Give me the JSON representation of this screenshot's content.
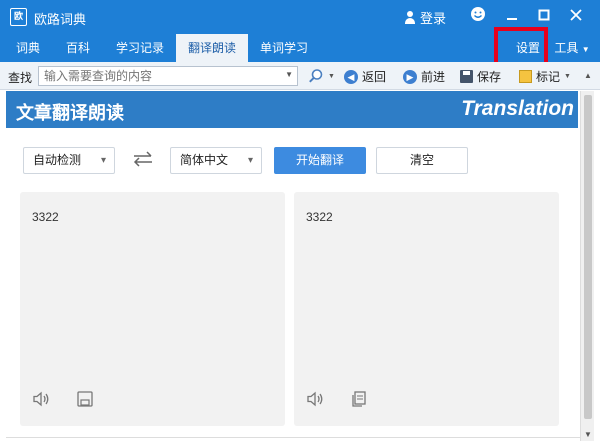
{
  "window": {
    "title": "欧路词典",
    "logo_text": "欧",
    "login": "登录",
    "colors": {
      "titlebar": "#1e7fd6",
      "accent": "#3d8be0",
      "highlight": "#e8001c"
    }
  },
  "tabs": [
    {
      "label": "词典",
      "active": false
    },
    {
      "label": "百科",
      "active": false
    },
    {
      "label": "学习记录",
      "active": false
    },
    {
      "label": "翻译朗读",
      "active": true
    },
    {
      "label": "单词学习",
      "active": false
    }
  ],
  "right_menu": {
    "settings": "设置",
    "tools": "工具"
  },
  "toolbar": {
    "search_label": "查找",
    "search_placeholder": "输入需要查询的内容",
    "back": "返回",
    "forward": "前进",
    "save": "保存",
    "mark": "标记"
  },
  "banner": {
    "title": "文章翻译朗读",
    "subtitle": "Translation"
  },
  "controls": {
    "source_lang": "自动检测",
    "target_lang": "简体中文",
    "translate_button": "开始翻译",
    "clear_button": "清空"
  },
  "panels": {
    "source_text": "3322",
    "result_text": "3322"
  },
  "icons": [
    "user-icon",
    "smiley-icon",
    "minimize-icon",
    "maximize-icon",
    "close-icon",
    "search-icon",
    "back-icon",
    "forward-icon",
    "save-icon",
    "mark-icon",
    "swap-icon",
    "speaker-icon",
    "copy-icon"
  ]
}
